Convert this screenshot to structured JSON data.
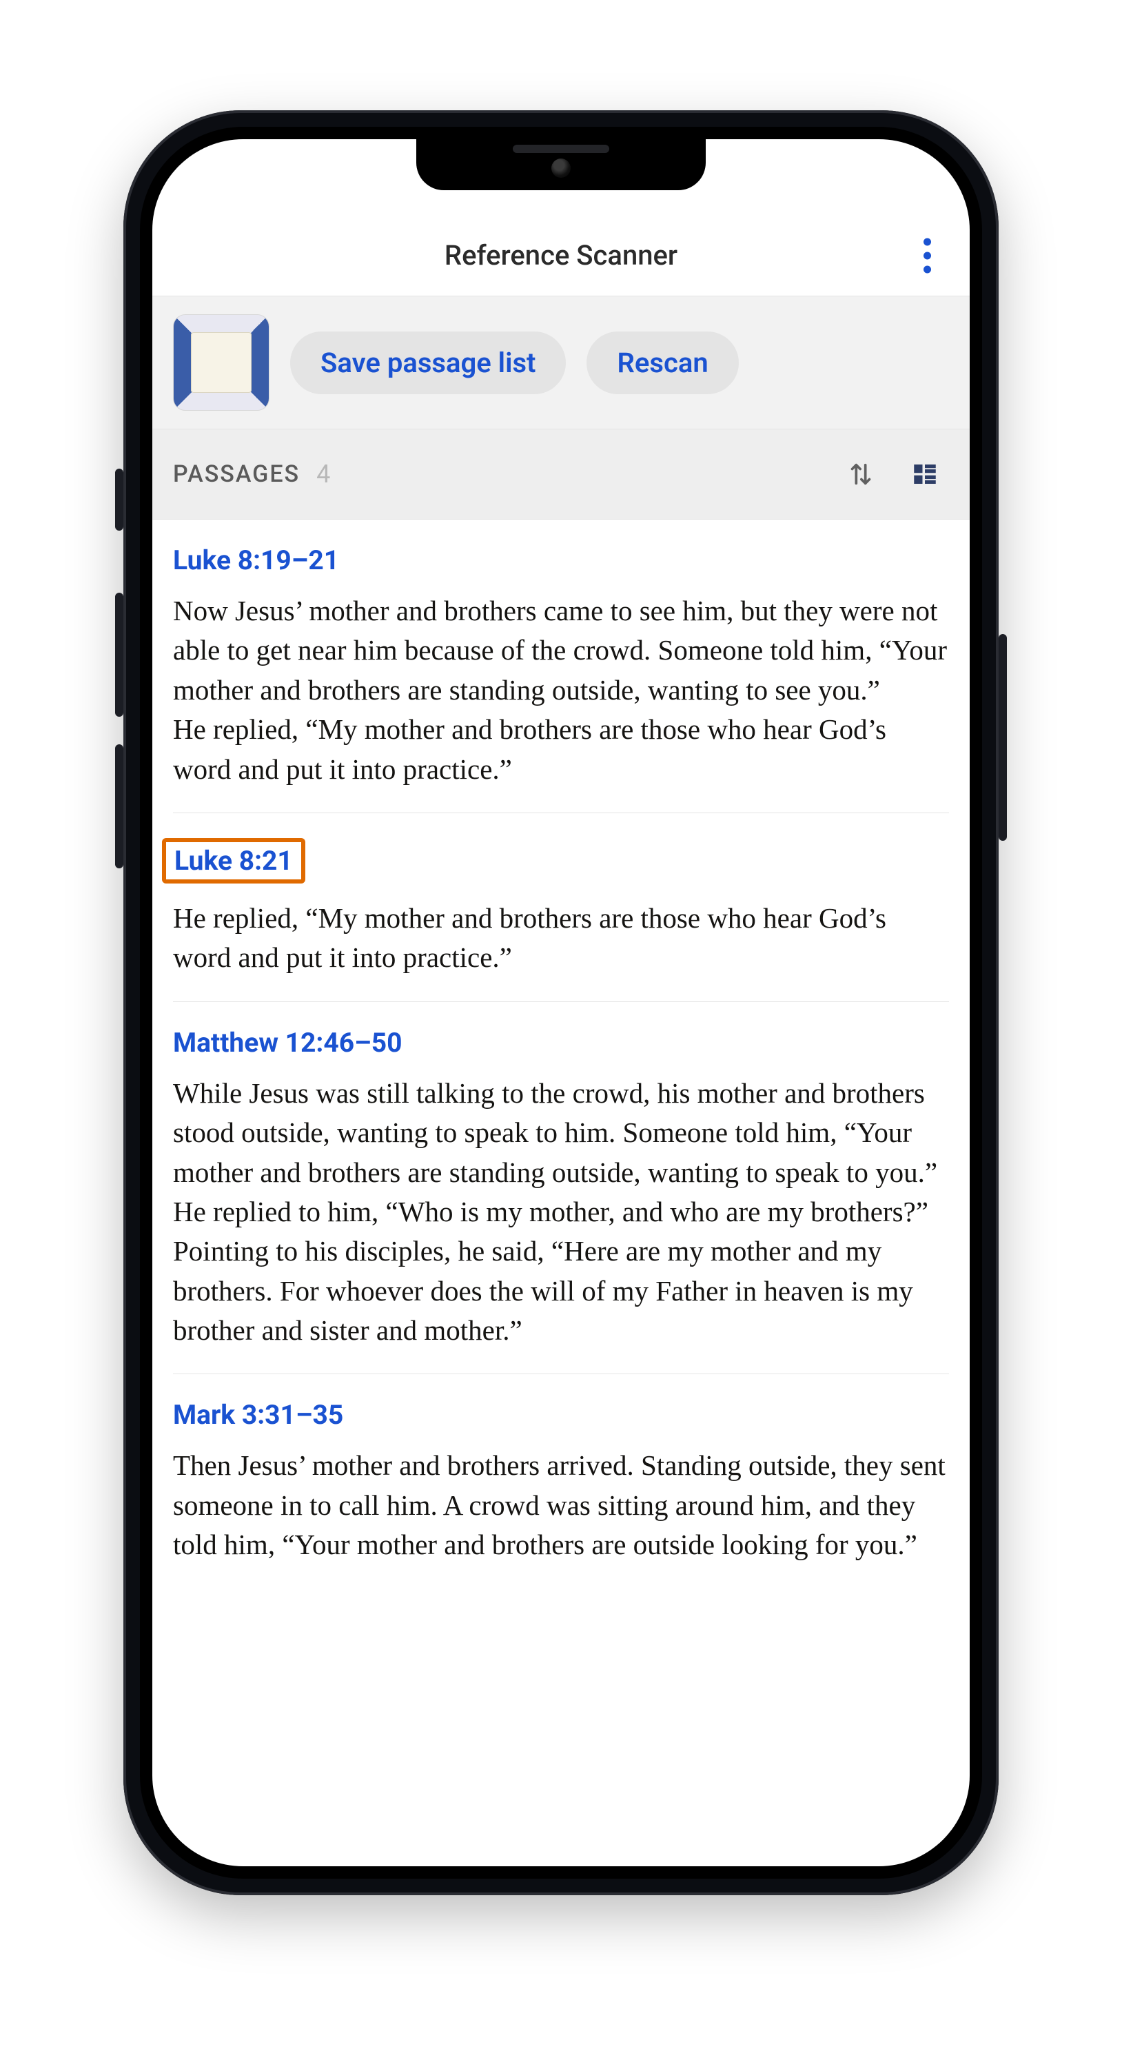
{
  "appbar": {
    "title": "Reference Scanner",
    "more_icon": "more-vert-icon"
  },
  "action_strip": {
    "thumb_alt": "scanned-photo",
    "save_label": "Save passage list",
    "rescan_label": "Rescan"
  },
  "section": {
    "label": "PASSAGES",
    "count": "4",
    "sort_icon": "sort-arrows-icon",
    "view_icon": "view-list-icon"
  },
  "passages": [
    {
      "ref": "Luke 8:19–21",
      "highlighted": false,
      "text": "Now Jesus’ mother and brothers came to see him, but they were not able to get near him because of the crowd. Someone told him, “Your mother and brothers are standing outside, wanting to see you.”\nHe replied, “My mother and brothers are those who hear God’s word and put it into practice.”"
    },
    {
      "ref": "Luke 8:21",
      "highlighted": true,
      "text": "He replied, “My mother and brothers are those who hear God’s word and put it into practice.”"
    },
    {
      "ref": "Matthew 12:46–50",
      "highlighted": false,
      "text": "While Jesus was still talking to the crowd, his mother and brothers stood outside, wanting to speak to him. Someone told him, “Your mother and brothers are standing outside, wanting to speak to you.”\nHe replied to him, “Who is my mother, and who are my brothers?” Pointing to his disciples, he said, “Here are my mother and my brothers. For whoever does the will of my Father in heaven is my brother and sister and mother.”"
    },
    {
      "ref": "Mark 3:31–35",
      "highlighted": false,
      "text": "Then Jesus’ mother and brothers arrived. Standing outside, they sent someone in to call him. A crowd was sitting around him, and they told him, “Your mother and brothers are outside looking for you.”"
    }
  ],
  "colors": {
    "accent": "#1a52d1",
    "highlight_ring": "#e06a00"
  }
}
